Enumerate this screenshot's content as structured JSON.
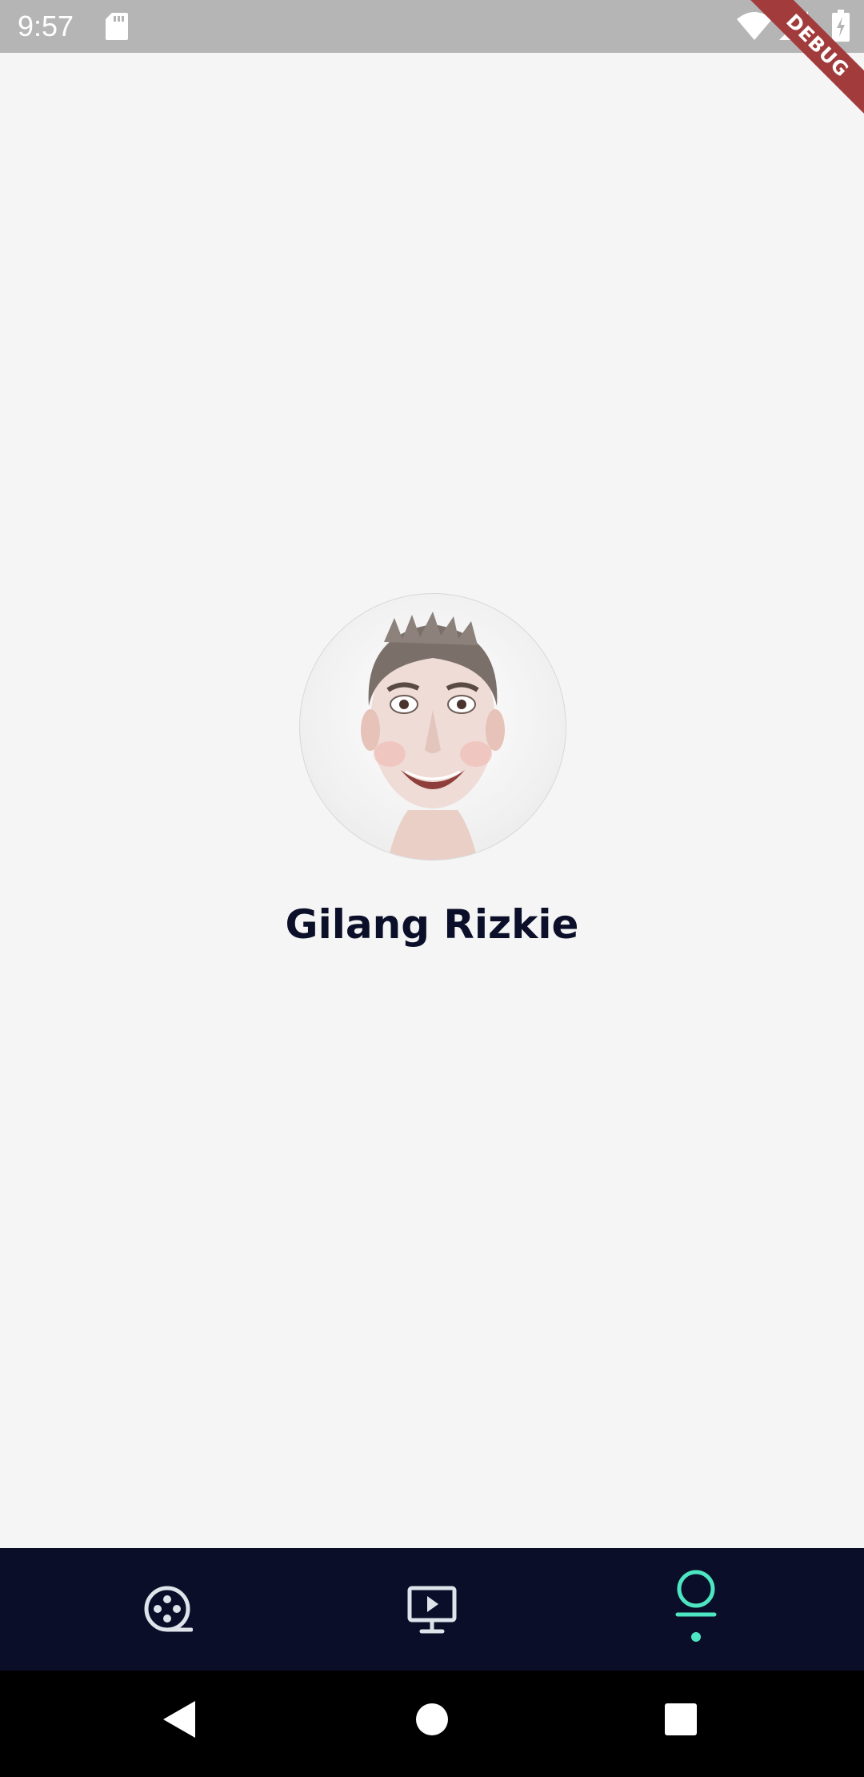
{
  "status_bar": {
    "time": "9:57",
    "icons": [
      "sd-card-icon",
      "wifi-icon",
      "signal-icon",
      "battery-charging-icon"
    ]
  },
  "debug_banner": {
    "label": "DEBUG"
  },
  "profile": {
    "name": "Gilang Rizkie"
  },
  "bottom_nav": {
    "items": [
      {
        "icon": "film-reel-icon",
        "active": false
      },
      {
        "icon": "tv-play-icon",
        "active": false
      },
      {
        "icon": "profile-icon",
        "active": true
      }
    ],
    "colors": {
      "background": "#0a0e29",
      "inactive": "#dfe3ea",
      "active": "#4ee6c2"
    }
  },
  "system_nav": {
    "buttons": [
      "back-icon",
      "home-icon",
      "recents-icon"
    ]
  }
}
